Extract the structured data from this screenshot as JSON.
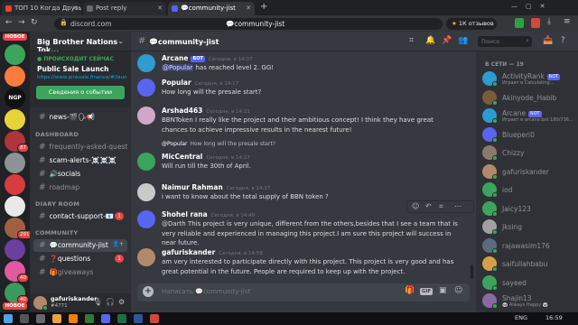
{
  "browser": {
    "tabs": [
      {
        "title": "ТОП 10 Когда Друзья...",
        "active": false
      },
      {
        "title": "Post reply",
        "active": false
      },
      {
        "title": "💬community-jist",
        "active": true
      }
    ],
    "url": "discord.com",
    "page_title": "💬community-jist",
    "reviews_label": "1К отзывов"
  },
  "rail": {
    "new_label_1": "НОВОЕ",
    "new_label_2": "НОВОЕ",
    "servers": [
      {
        "label": "",
        "color": "#3ba55d",
        "badge": ""
      },
      {
        "label": "",
        "color": "#ff7a3d",
        "badge": ""
      },
      {
        "label": "NGP",
        "color": "#111111",
        "badge": ""
      },
      {
        "label": "",
        "color": "#e8d23a",
        "badge": ""
      },
      {
        "label": "",
        "color": "#b0343c",
        "badge": "87"
      },
      {
        "label": "",
        "color": "#8e9297",
        "badge": ""
      },
      {
        "label": "",
        "color": "#d83c3e",
        "badge": ""
      },
      {
        "label": "",
        "color": "#e9e9e9",
        "badge": ""
      },
      {
        "label": "",
        "color": "#a06040",
        "badge": "291"
      },
      {
        "label": "",
        "color": "#6a3fa0",
        "badge": ""
      },
      {
        "label": "",
        "color": "#e05aa0",
        "badge": "40"
      },
      {
        "label": "",
        "color": "#3a9a5b",
        "badge": "40"
      }
    ]
  },
  "sidebar": {
    "guild_name": "Big Brother Nations Tok...",
    "event_status": "ПРОИСХОДИТ СЕЙЧАС",
    "event_title": "Public Sale Launch",
    "event_link": "https://www.pinksale.finance/#/laun...",
    "event_button": "Сведения о событии",
    "top_channels": [
      {
        "name": "news-🎬🗣📢",
        "unread": true
      }
    ],
    "categories": [
      {
        "name": "DASHBOARD",
        "channels": [
          {
            "name": "frequently-asked-quest...",
            "unread": false,
            "badge": ""
          },
          {
            "name": "scam-alerts-☠️☠️☠️",
            "unread": true,
            "badge": ""
          },
          {
            "name": "🔊socials",
            "unread": true,
            "badge": ""
          },
          {
            "name": "roadmap",
            "unread": false,
            "badge": ""
          }
        ]
      },
      {
        "name": "DIARY ROOM",
        "channels": [
          {
            "name": "contact-support-📧",
            "unread": true,
            "badge": "1"
          }
        ]
      },
      {
        "name": "COMMUNITY",
        "channels": [
          {
            "name": "💬community-jist",
            "unread": true,
            "badge": "",
            "selected": true
          },
          {
            "name": "❓questions",
            "unread": true,
            "badge": "1"
          },
          {
            "name": "🎁giveaways",
            "unread": false,
            "badge": ""
          }
        ]
      }
    ],
    "user": {
      "name": "gafuriskander",
      "tag": "#4771"
    }
  },
  "chat": {
    "messages": [
      {
        "author": "Arcane",
        "bot": true,
        "bot_label": "БОТ",
        "time": "Сегодня, в 14:07",
        "color": "#ffffff",
        "avatar": "#2f9bd0",
        "pre": "",
        "mention": "@Popular",
        "text": " has reached level 2. GG!"
      },
      {
        "author": "Popular",
        "bot": false,
        "time": "Сегодня, в 14:17",
        "color": "#ffffff",
        "avatar": "#5865f2",
        "pre": "",
        "mention": "",
        "text": "How long will the presale start?"
      },
      {
        "author": "Arshad463",
        "bot": false,
        "time": "Сегодня, в 14:21",
        "color": "#ffffff",
        "avatar": "#d1a7c9",
        "pre": "",
        "mention": "",
        "text": "BBNToken I really like the project and their ambitious concept! I think they have great chances to achieve impressive results in the nearest future!"
      },
      {
        "author": "MicCentral",
        "bot": false,
        "time": "Сегодня, в 14:27",
        "color": "#ffffff",
        "avatar": "#3ba55d",
        "pre": "",
        "mention": "",
        "text": "Will run till the 30th of April.",
        "reply_mention": "@Popular",
        "reply_text": "How long will the presale start?"
      },
      {
        "author": "Naimur Rahman",
        "bot": false,
        "time": "Сегодня, в 14:37",
        "color": "#ffffff",
        "avatar": "#c9c9c9",
        "pre": "",
        "mention": "",
        "text": "i want to know about the total supply of BBN token ?"
      },
      {
        "author": "Shohel rana",
        "bot": false,
        "time": "Сегодня, в 14:49",
        "color": "#ffffff",
        "avatar": "#5865f2",
        "pre": "",
        "mention": "",
        "text": "@Darth This project is very unique, different from the others,besides that I see a team that is very reliable and experienced in managing this project.I am sure this project will success in near future."
      },
      {
        "author": "gafuriskander",
        "bot": false,
        "time": "Сегодня, в 14:59",
        "color": "#ffffff",
        "avatar": "#b08a6a",
        "pre": "",
        "mention": "",
        "text": "am very interested to participate directly with this project. This project is very good and has great potential in the future. People are required to keep up with the project."
      }
    ],
    "composer_placeholder": "Написать 💬community-jist"
  },
  "members": {
    "search_placeholder": "Поиск",
    "section": "В СЕТИ — 19",
    "list": [
      {
        "name": "ActivityRank",
        "bot": true,
        "status": "Играет в Calculating...",
        "color": "#2f9bd0"
      },
      {
        "name": "Akinyode_Habib",
        "bot": false,
        "status": "",
        "color": "#7a5c3a"
      },
      {
        "name": "Arcane",
        "bot": true,
        "status": "Играет в arcane.bot 180/736...",
        "color": "#2f9bd0"
      },
      {
        "name": "Blueperi0",
        "bot": false,
        "status": "",
        "color": "#5865f2"
      },
      {
        "name": "Chizzy",
        "bot": false,
        "status": "",
        "color": "#8a7a6a"
      },
      {
        "name": "gafuriskander",
        "bot": false,
        "status": "",
        "color": "#b08a6a"
      },
      {
        "name": "iod",
        "bot": false,
        "status": "",
        "color": "#3ba55d"
      },
      {
        "name": "Jaicy123",
        "bot": false,
        "status": "",
        "color": "#3ba55d"
      },
      {
        "name": "Jksing",
        "bot": false,
        "status": "",
        "color": "#a0a0a0"
      },
      {
        "name": "rajawasim176",
        "bot": false,
        "status": "",
        "color": "#5c6b7a"
      },
      {
        "name": "saifullahbabu",
        "bot": false,
        "status": "",
        "color": "#d6a04a"
      },
      {
        "name": "sayeed",
        "bot": false,
        "status": "",
        "color": "#3ba55d"
      },
      {
        "name": "Shajin13",
        "bot": false,
        "status": "🐼 Always Happy 🐼",
        "color": "#8a6aa0"
      }
    ]
  },
  "taskbar": {
    "lang": "ENG",
    "time": "16:59"
  }
}
